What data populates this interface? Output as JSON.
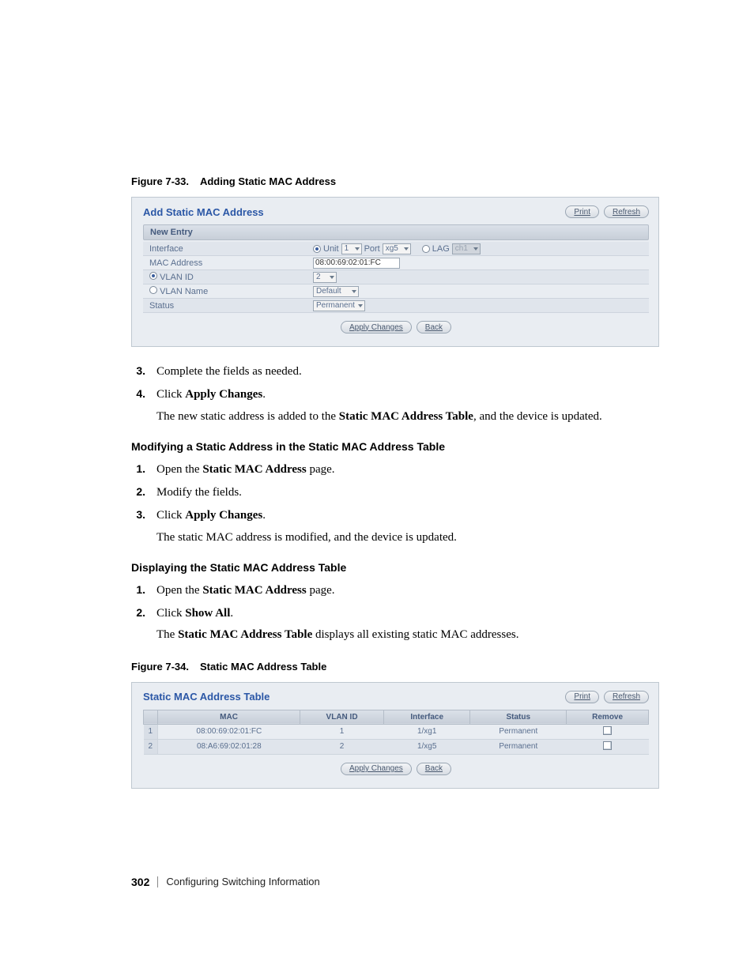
{
  "figure1": {
    "caption_prefix": "Figure 7-33.",
    "caption_title": "Adding Static MAC Address",
    "panel_title": "Add Static MAC Address",
    "print_label": "Print",
    "refresh_label": "Refresh",
    "section_label": "New Entry",
    "rows": {
      "interface_label": "Interface",
      "unit_label": "Unit",
      "unit_value": "1",
      "port_label": "Port",
      "port_value": "xg5",
      "lag_label": "LAG",
      "lag_value": "ch1",
      "mac_label": "MAC Address",
      "mac_value": "08:00:69:02:01:FC",
      "vlanid_label": "VLAN ID",
      "vlanid_value": "2",
      "vlanname_label": "VLAN Name",
      "vlanname_value": "Default",
      "status_label": "Status",
      "status_value": "Permanent"
    },
    "apply_label": "Apply Changes",
    "back_label": "Back"
  },
  "steps_a": {
    "s3_num": "3.",
    "s3_text": "Complete the fields as needed.",
    "s4_num": "4.",
    "s4_text_pre": "Click ",
    "s4_bold": "Apply Changes",
    "s4_text_post": ".",
    "s4_result_pre": "The new static address is added to the ",
    "s4_result_bold": "Static MAC Address Table",
    "s4_result_post": ", and the device is updated."
  },
  "section_b_head": "Modifying a Static Address in the Static MAC Address Table",
  "steps_b": {
    "s1_num": "1.",
    "s1_pre": "Open the ",
    "s1_bold": "Static MAC Address",
    "s1_post": " page.",
    "s2_num": "2.",
    "s2_text": "Modify the fields.",
    "s3_num": "3.",
    "s3_pre": "Click ",
    "s3_bold": "Apply Changes",
    "s3_post": ".",
    "s3_result": "The static MAC address is modified, and the device is updated."
  },
  "section_c_head": "Displaying the Static MAC Address Table",
  "steps_c": {
    "s1_num": "1.",
    "s1_pre": "Open the ",
    "s1_bold": "Static MAC Address",
    "s1_post": " page.",
    "s2_num": "2.",
    "s2_pre": "Click ",
    "s2_bold": "Show All",
    "s2_post": ".",
    "s2_result_pre": "The ",
    "s2_result_bold": "Static MAC Address Table",
    "s2_result_post": " displays all existing static MAC addresses."
  },
  "figure2": {
    "caption_prefix": "Figure 7-34.",
    "caption_title": "Static MAC Address Table",
    "panel_title": "Static MAC Address Table",
    "print_label": "Print",
    "refresh_label": "Refresh",
    "headers": {
      "blank": "",
      "mac": "MAC",
      "vlan": "VLAN ID",
      "iface": "Interface",
      "status": "Status",
      "remove": "Remove"
    },
    "rows": [
      {
        "idx": "1",
        "mac": "08:00:69:02:01:FC",
        "vlan": "1",
        "iface": "1/xg1",
        "status": "Permanent"
      },
      {
        "idx": "2",
        "mac": "08:A6:69:02:01:28",
        "vlan": "2",
        "iface": "1/xg5",
        "status": "Permanent"
      }
    ],
    "apply_label": "Apply Changes",
    "back_label": "Back"
  },
  "footer": {
    "page_num": "302",
    "chapter": "Configuring Switching Information"
  }
}
